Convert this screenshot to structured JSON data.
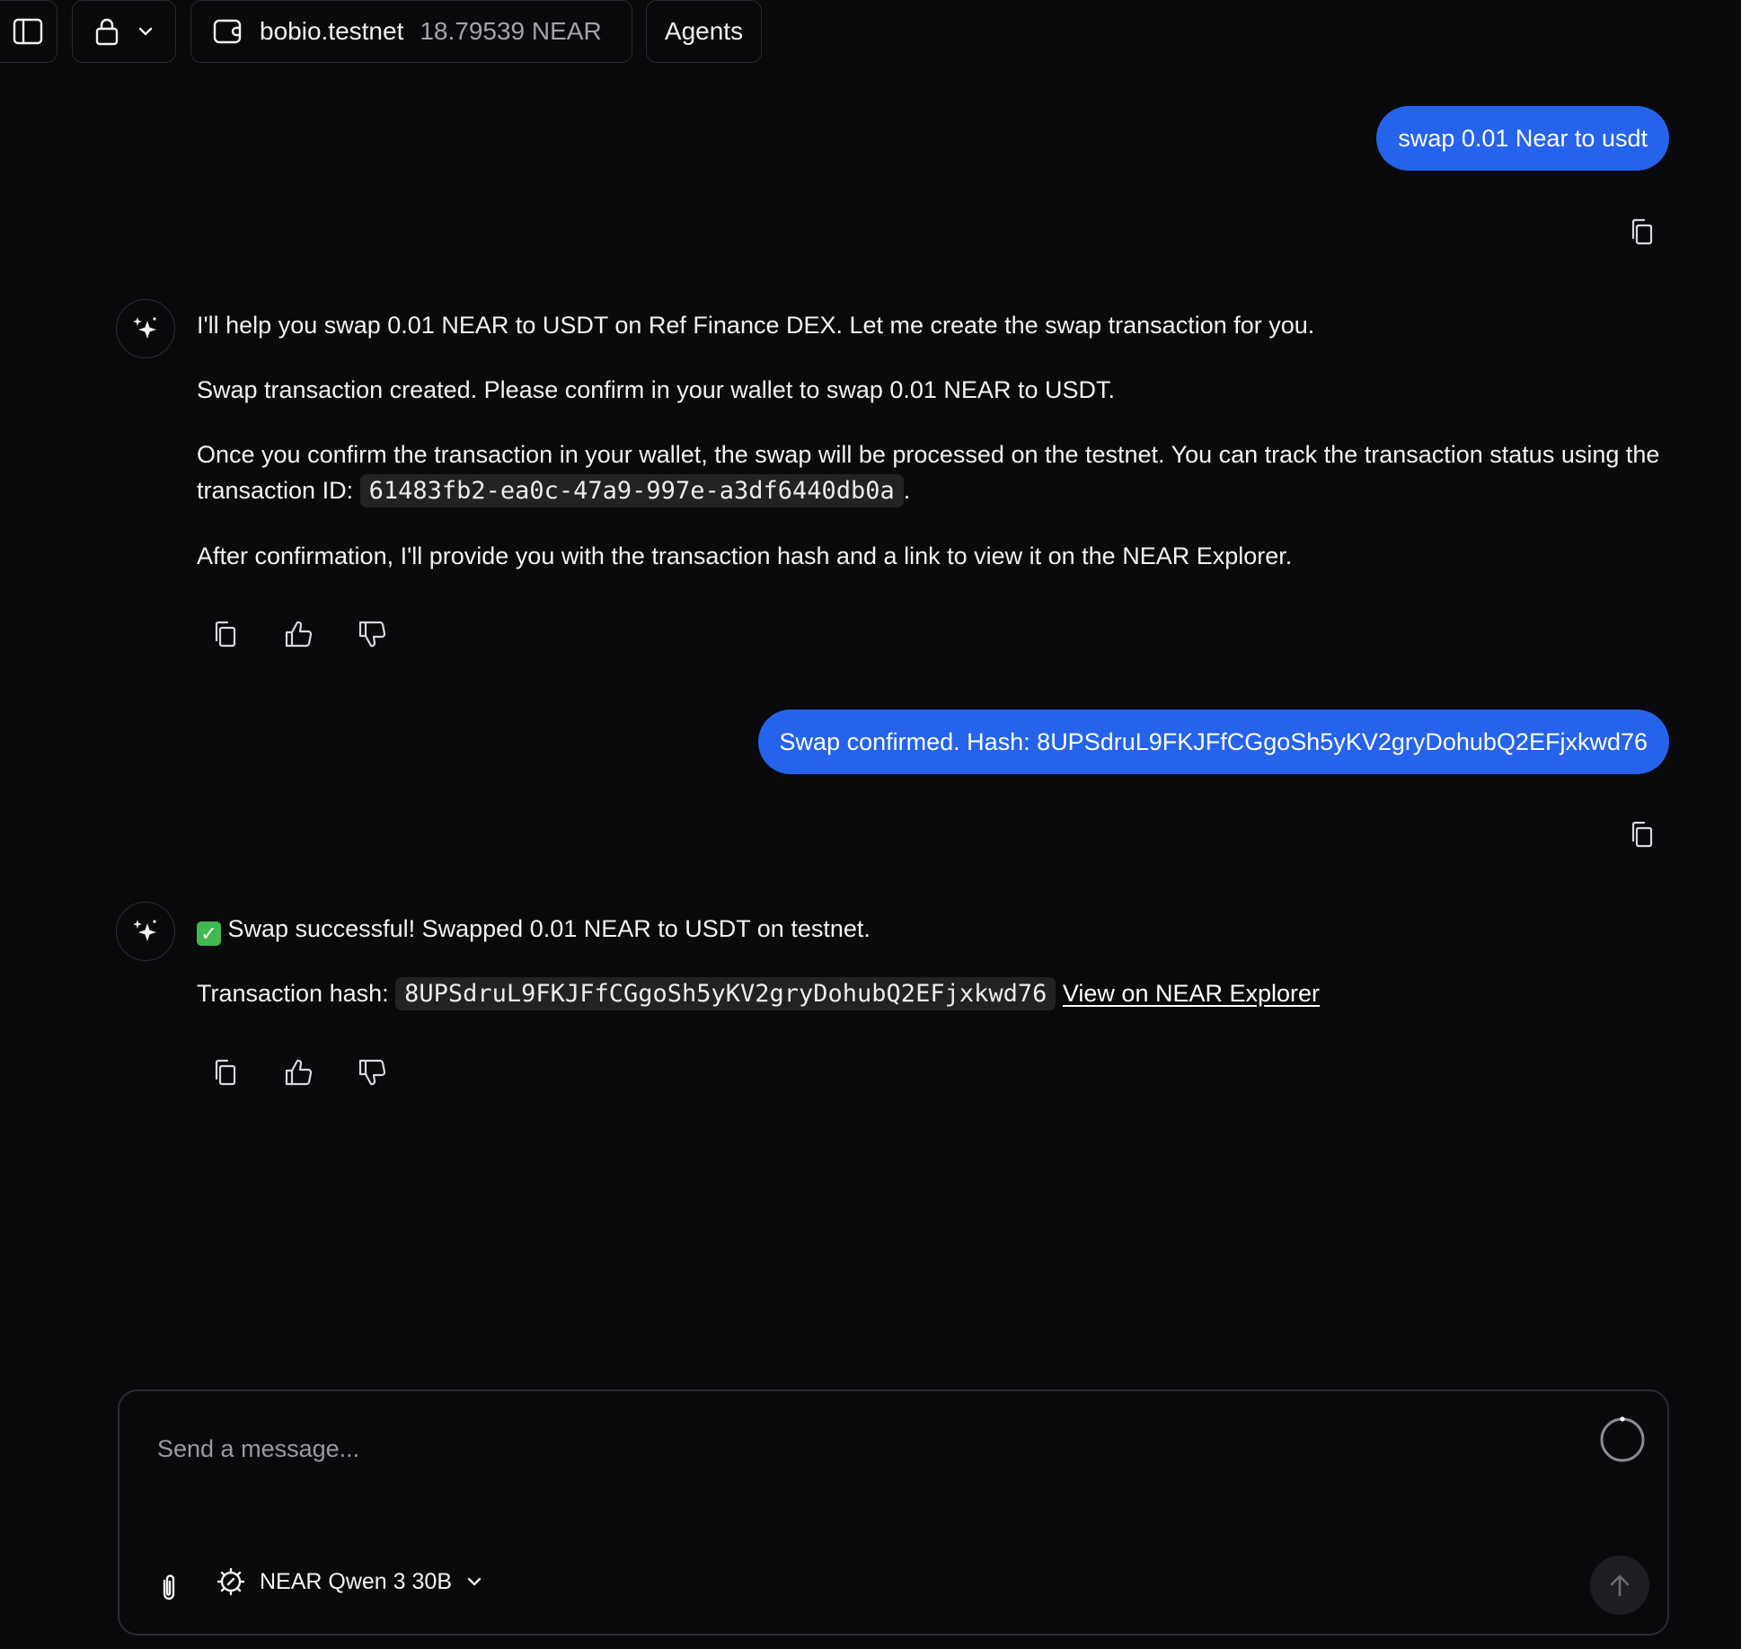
{
  "topbar": {
    "wallet_name": "bobio.testnet",
    "wallet_balance": "18.79539 NEAR",
    "agents_label": "Agents"
  },
  "messages": {
    "user1": "swap 0.01 Near to usdt",
    "ai1": {
      "p1": "I'll help you swap 0.01 NEAR to USDT on Ref Finance DEX. Let me create the swap transaction for you.",
      "p2": "Swap transaction created. Please confirm in your wallet to swap 0.01 NEAR to USDT.",
      "p3_before": "Once you confirm the transaction in your wallet, the swap will be processed on the testnet. You can track the transaction status using the transaction ID: ",
      "p3_code": "61483fb2-ea0c-47a9-997e-a3df6440db0a",
      "p3_after": ".",
      "p4": "After confirmation, I'll provide you with the transaction hash and a link to view it on the NEAR Explorer."
    },
    "user2": "Swap confirmed. Hash: 8UPSdruL9FKJFfCGgoSh5yKV2gryDohubQ2EFjxkwd76",
    "ai2": {
      "p1": "Swap successful! Swapped 0.01 NEAR to USDT on testnet.",
      "hash_label": "Transaction hash: ",
      "hash_code": "8UPSdruL9FKJFfCGgoSh5yKV2gryDohubQ2EFjxkwd76",
      "explorer_link": "View on NEAR Explorer"
    }
  },
  "composer": {
    "placeholder": "Send a message...",
    "model_name": "NEAR Qwen 3 30B"
  },
  "colors": {
    "background": "#0a0a0c",
    "user_bubble": "#2563eb",
    "success_check": "#3fb950"
  },
  "icons": [
    "sidebar-toggle-icon",
    "lock-icon",
    "chevron-down-icon",
    "wallet-icon",
    "copy-icon",
    "sparkle-icon",
    "thumbs-up-icon",
    "thumbs-down-icon",
    "check-icon",
    "paperclip-icon",
    "model-chip-icon",
    "spinner-icon",
    "arrow-up-icon"
  ]
}
